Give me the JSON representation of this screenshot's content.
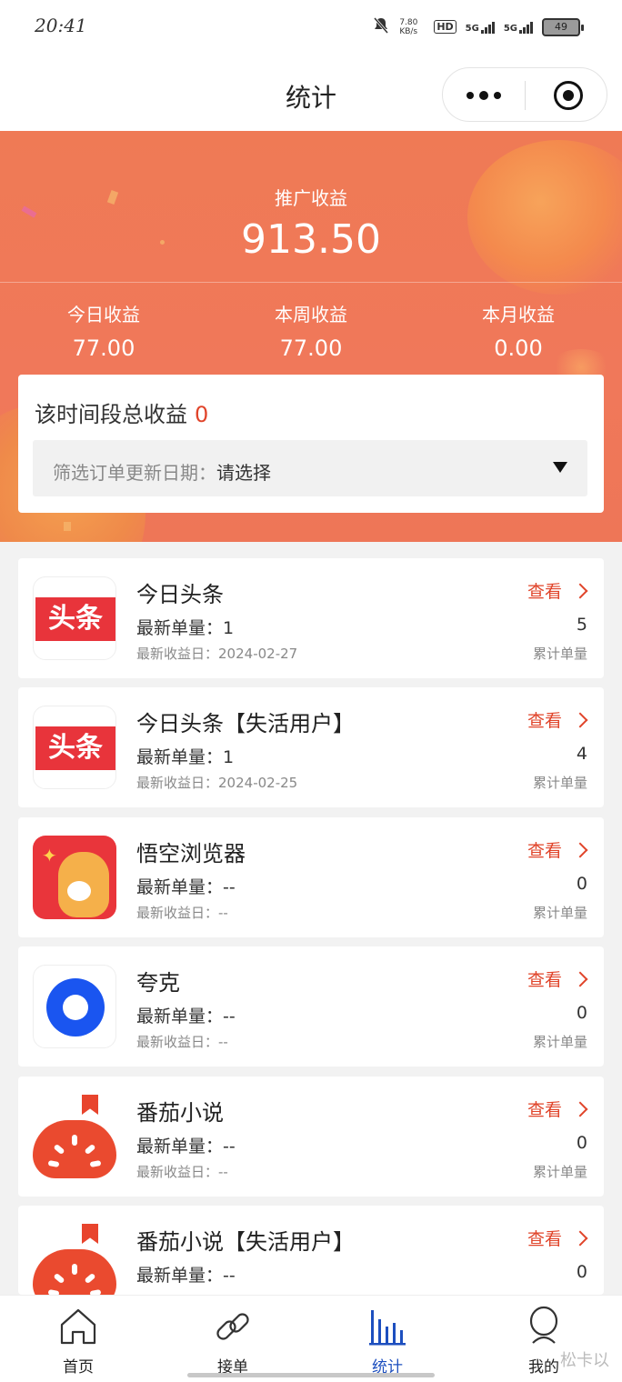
{
  "status_bar": {
    "time": "20:41",
    "net_speed": "7.80 KB/s",
    "hd": "HD",
    "signal1": "5G",
    "signal2": "5G",
    "battery": "49"
  },
  "title_bar": {
    "title": "统计"
  },
  "summary": {
    "main_label": "推广收益",
    "main_value": "913.50",
    "stats": [
      {
        "label": "今日收益",
        "value": "77.00"
      },
      {
        "label": "本周收益",
        "value": "77.00"
      },
      {
        "label": "本月收益",
        "value": "0.00"
      }
    ]
  },
  "filter": {
    "total_label": "该时间段总收益",
    "total_value": "0",
    "date_label": "筛选订单更新日期：",
    "date_value": "请选择"
  },
  "list": {
    "latest_label": "最新单量：",
    "date_label": "最新收益日：",
    "view_label": "查看",
    "count_label": "累计单量",
    "items": [
      {
        "name": "今日头条",
        "latest": "1",
        "date": "2024-02-27",
        "count": "5",
        "logo": "toutiao"
      },
      {
        "name": "今日头条【失活用户】",
        "latest": "1",
        "date": "2024-02-25",
        "count": "4",
        "logo": "toutiao"
      },
      {
        "name": "悟空浏览器",
        "latest": "--",
        "date": "--",
        "count": "0",
        "logo": "wukong"
      },
      {
        "name": "夸克",
        "latest": "--",
        "date": "--",
        "count": "0",
        "logo": "kuake"
      },
      {
        "name": "番茄小说",
        "latest": "--",
        "date": "--",
        "count": "0",
        "logo": "fanqie"
      },
      {
        "name": "番茄小说【失活用户】",
        "latest": "--",
        "date": "--",
        "count": "0",
        "logo": "fanqie"
      }
    ],
    "logo_text": {
      "toutiao": "头条"
    }
  },
  "tabbar": {
    "items": [
      {
        "label": "首页",
        "icon": "home-icon"
      },
      {
        "label": "接单",
        "icon": "link-icon"
      },
      {
        "label": "统计",
        "icon": "bar-chart-icon",
        "active": true
      },
      {
        "label": "我的",
        "icon": "user-icon"
      }
    ]
  },
  "watermark": "松卡以",
  "colors": {
    "accent": "#e0442a",
    "banner": "#ef7a55",
    "active_tab": "#1d4fbf"
  }
}
